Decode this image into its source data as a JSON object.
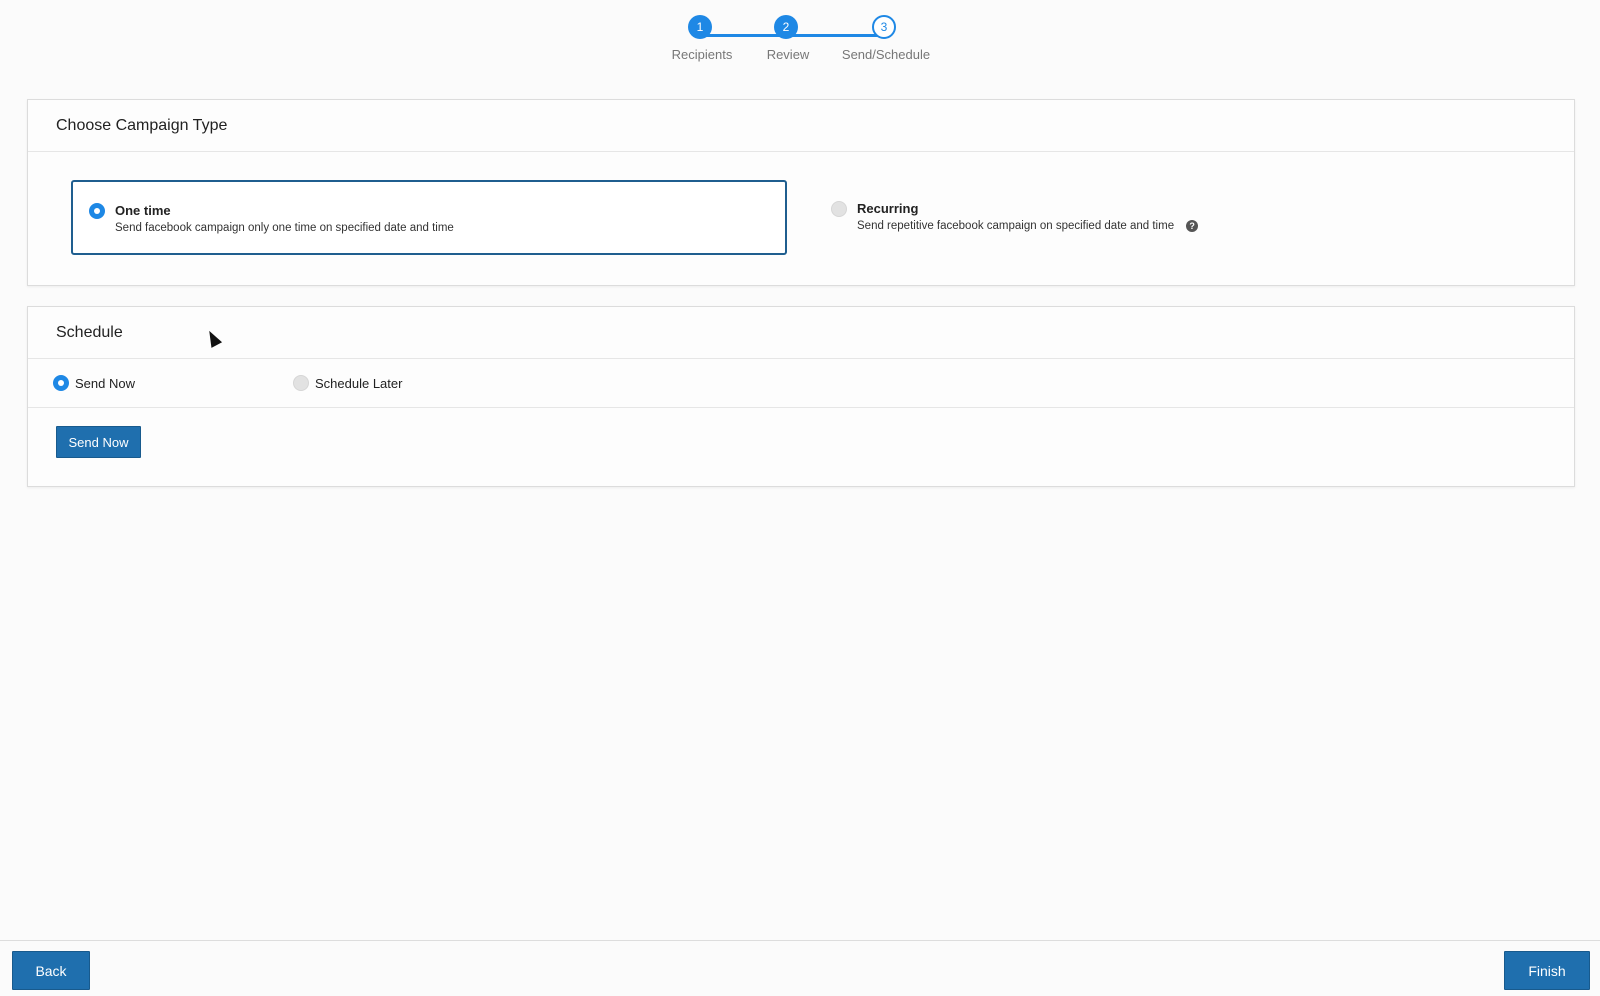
{
  "stepper": {
    "steps": [
      {
        "number": "1",
        "label": "Recipients",
        "state": "done"
      },
      {
        "number": "2",
        "label": "Review",
        "state": "done"
      },
      {
        "number": "3",
        "label": "Send/Schedule",
        "state": "current"
      }
    ],
    "accent_color": "#1e88e5"
  },
  "campaign_type": {
    "title": "Choose Campaign Type",
    "options": [
      {
        "title": "One time",
        "description": "Send facebook campaign only one time on specified date and time",
        "selected": true
      },
      {
        "title": "Recurring",
        "description": "Send repetitive facebook campaign on specified date and time",
        "selected": false,
        "help_icon": "question-circle-icon"
      }
    ]
  },
  "schedule": {
    "title": "Schedule",
    "options": [
      {
        "label": "Send Now",
        "selected": true
      },
      {
        "label": "Schedule Later",
        "selected": false
      }
    ],
    "action_button": "Send Now"
  },
  "footer": {
    "back_label": "Back",
    "finish_label": "Finish",
    "button_color": "#1f6fae"
  }
}
